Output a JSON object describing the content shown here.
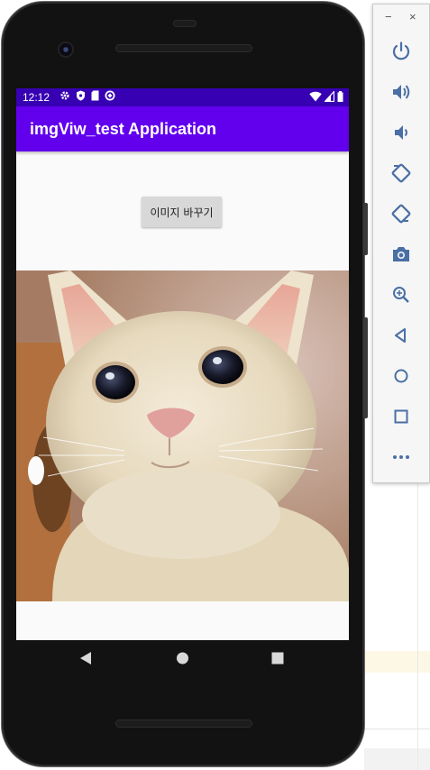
{
  "status_bar": {
    "time": "12:12"
  },
  "app": {
    "title": "imgViw_test Application"
  },
  "main": {
    "button_label": "이미지 바꾸기"
  },
  "emulator": {
    "minimize": "−",
    "close": "×",
    "more": "•••",
    "buttons": [
      "power",
      "volume-up",
      "volume-down",
      "rotate-left",
      "rotate-right",
      "screenshot",
      "zoom",
      "back",
      "home",
      "overview",
      "more"
    ]
  },
  "colors": {
    "status_bar": "#3700b3",
    "app_bar": "#6200ee",
    "toolbar_icon": "#4a6fa5"
  }
}
